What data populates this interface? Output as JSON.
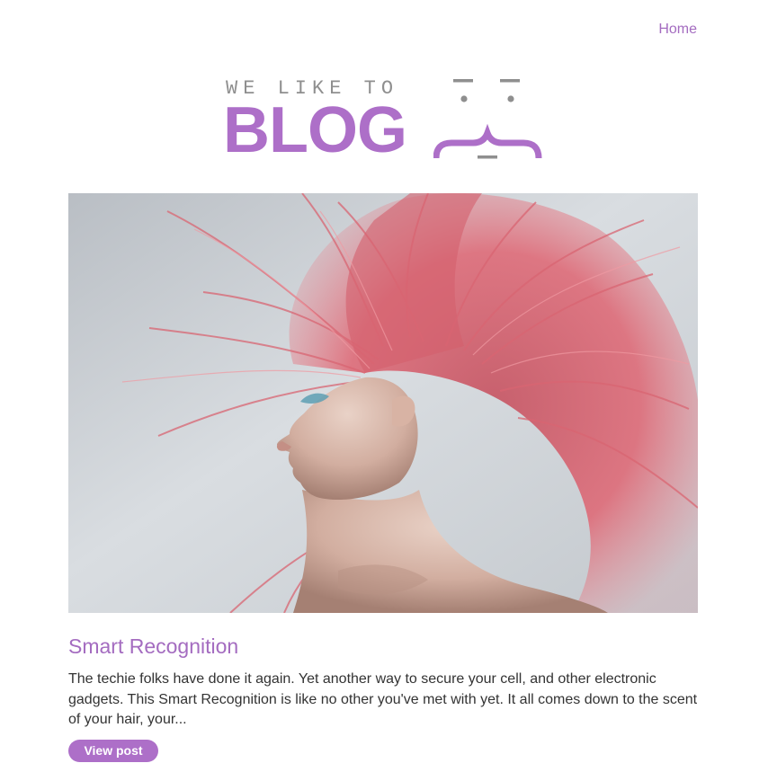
{
  "nav": {
    "home_label": "Home"
  },
  "logo": {
    "tagline": "WE LIKE TO",
    "word": "BLOG"
  },
  "hero": {
    "icon": "photo-woman-pink-hair"
  },
  "post": {
    "title": "Smart Recognition",
    "excerpt": "The techie folks have done it again. Yet another way to secure your cell, and other electronic gadgets. This Smart Recognition is like no other you've met with yet. It all comes down to the scent of your hair, your...",
    "button_label": "View post"
  },
  "colors": {
    "accent": "#a46cc0",
    "logo_gray": "#8f8f8f",
    "text": "#333333"
  }
}
